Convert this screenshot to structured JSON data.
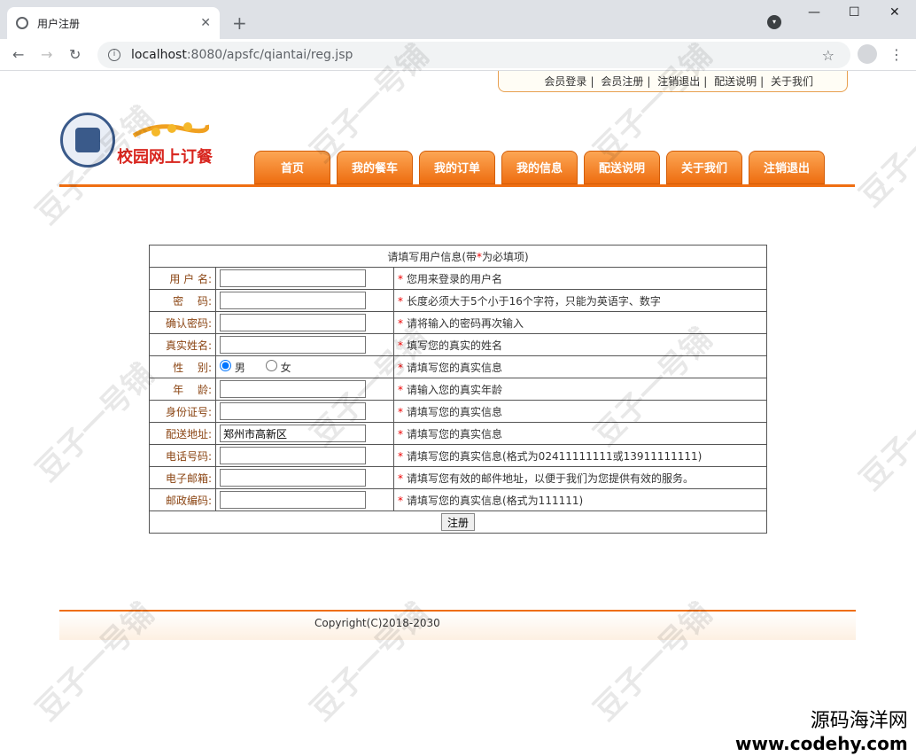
{
  "browser": {
    "tab_title": "用户注册",
    "url_host": "localhost",
    "url_rest": ":8080/apsfc/qiantai/reg.jsp"
  },
  "toplinks": [
    "会员登录",
    "会员注册",
    "注销退出",
    "配送说明",
    "关于我们"
  ],
  "logo": {
    "text": "校园网上订餐"
  },
  "nav": [
    "首页",
    "我的餐车",
    "我的订单",
    "我的信息",
    "配送说明",
    "关于我们",
    "注销退出"
  ],
  "form": {
    "header_pre": "请填写用户信息(带",
    "header_star": "*",
    "header_post": "为必填项)",
    "rows": [
      {
        "label": "用 户 名:",
        "hint": "您用来登录的用户名",
        "value": ""
      },
      {
        "label": "密　 码:",
        "hint": "长度必须大于5个小于16个字符，只能为英语字、数字",
        "value": ""
      },
      {
        "label": "确认密码:",
        "hint": "请将输入的密码再次输入",
        "value": ""
      },
      {
        "label": "真实姓名:",
        "hint": "填写您的真实的姓名",
        "value": ""
      },
      {
        "label": "性　 别:",
        "hint": "请填写您的真实信息",
        "gender": [
          "男",
          "女"
        ]
      },
      {
        "label": "年　 龄:",
        "hint": "请输入您的真实年龄",
        "value": ""
      },
      {
        "label": "身份证号:",
        "hint": "请填写您的真实信息",
        "value": ""
      },
      {
        "label": "配送地址:",
        "hint": "请填写您的真实信息",
        "value": "郑州市高新区"
      },
      {
        "label": "电话号码:",
        "hint": "请填写您的真实信息(格式为02411111111或13911111111)",
        "value": ""
      },
      {
        "label": "电子邮箱:",
        "hint": "请填写您有效的邮件地址，以便于我们为您提供有效的服务。",
        "value": ""
      },
      {
        "label": "邮政编码:",
        "hint": "请填写您的真实信息(格式为111111)",
        "value": ""
      }
    ],
    "star": "*",
    "submit": "注册"
  },
  "footer": {
    "copyright": "Copyright(C)2018-2030"
  },
  "watermark": {
    "cn": "源码海洋网",
    "en": "www.codehy.com",
    "diag": "豆子一号铺"
  }
}
